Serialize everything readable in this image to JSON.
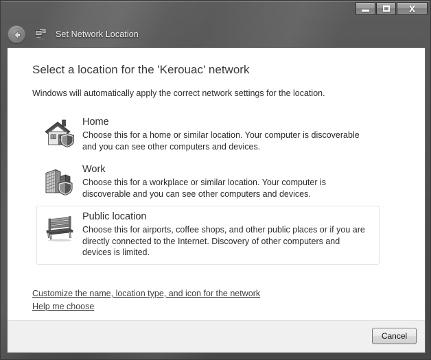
{
  "window": {
    "title": "Set Network Location",
    "nav_icon": "network-icon",
    "back_button_label": "Back",
    "caption": {
      "minimize_label": "Minimize",
      "maximize_label": "Maximize",
      "close_label": "Close",
      "close_glyph": "X"
    }
  },
  "page": {
    "heading": "Select a location for the 'Kerouac' network",
    "subtitle": "Windows will automatically apply the correct network settings for the location.",
    "network_name": "Kerouac"
  },
  "options": [
    {
      "id": "home",
      "icon": "house-shield-icon",
      "title": "Home",
      "description": "Choose this for a home or similar location. Your computer is discoverable and you can see other computers and devices.",
      "hovered": false
    },
    {
      "id": "work",
      "icon": "office-building-shield-icon",
      "title": "Work",
      "description": "Choose this for a workplace or similar location. Your computer is discoverable and you can see other computers and devices.",
      "hovered": false
    },
    {
      "id": "public",
      "icon": "park-bench-icon",
      "title": "Public location",
      "description": "Choose this for airports, coffee shops, and other public places or if you are directly connected to the Internet. Discovery of other computers and devices is limited.",
      "hovered": true
    }
  ],
  "links": [
    {
      "id": "customize",
      "label": "Customize the name, location type, and icon for the network"
    },
    {
      "id": "help",
      "label": "Help me choose"
    }
  ],
  "footer": {
    "cancel_label": "Cancel"
  },
  "colors": {
    "titlebar": "#4d4d4d",
    "client_bg": "#ffffff",
    "footer_bg": "#f0f0f0",
    "heading_text": "#3a3a3a",
    "body_text": "#2b2b2b",
    "hover_border": "#e2e2e2"
  }
}
